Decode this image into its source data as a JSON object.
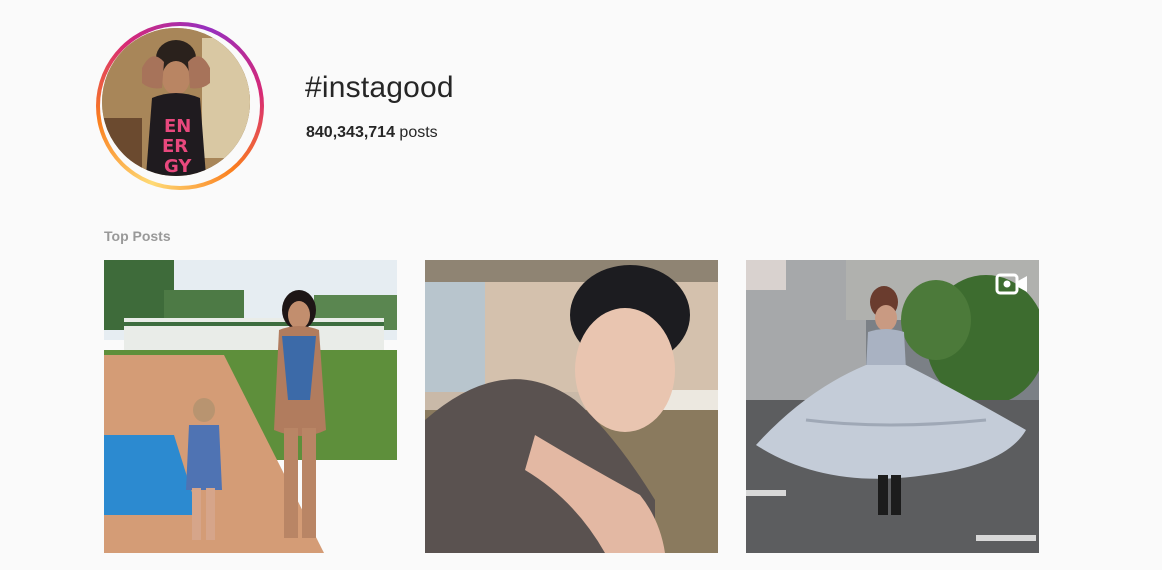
{
  "hashtag": {
    "title": "#instagood",
    "post_count_value": "840,343,714",
    "post_count_label": " posts",
    "avatar_icon": "profile-photo"
  },
  "top_posts": {
    "label": "Top Posts",
    "items": [
      {
        "kind": "photo",
        "icon": "photo"
      },
      {
        "kind": "photo",
        "icon": "photo"
      },
      {
        "kind": "video",
        "icon": "video-camera-icon"
      }
    ]
  },
  "colors": {
    "background": "#fafafa",
    "text": "#262626",
    "muted": "#999999",
    "ring_gradient": [
      "#feda75",
      "#fa7e1e",
      "#d62976",
      "#962fbf"
    ]
  }
}
